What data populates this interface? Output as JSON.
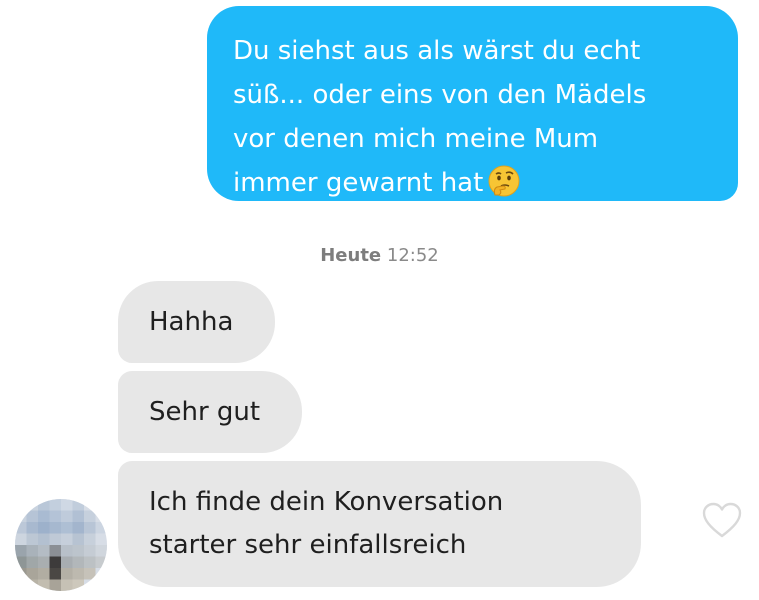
{
  "outgoing_message": {
    "lines": [
      "Du siehst aus als wärst du echt",
      "süß... oder eins von den Mädels",
      "vor denen mich meine Mum",
      "immer gewarnt hat"
    ],
    "emoji": "thinking-face-icon"
  },
  "timestamp": {
    "day": "Heute",
    "time": "12:52"
  },
  "incoming_messages": [
    {
      "lines": [
        "Hahha"
      ]
    },
    {
      "lines": [
        "Sehr gut"
      ]
    },
    {
      "lines": [
        "Ich finde dein Konversation",
        "starter sehr einfallsreich"
      ]
    }
  ],
  "colors": {
    "outgoing_bubble": "#1fb9f9",
    "incoming_bubble": "#e7e7e7",
    "timestamp_text": "#8a8a8a",
    "heart_outline": "#d9d9d9"
  },
  "icons": {
    "like": "heart-outline-icon",
    "avatar": "pixelated-avatar"
  }
}
